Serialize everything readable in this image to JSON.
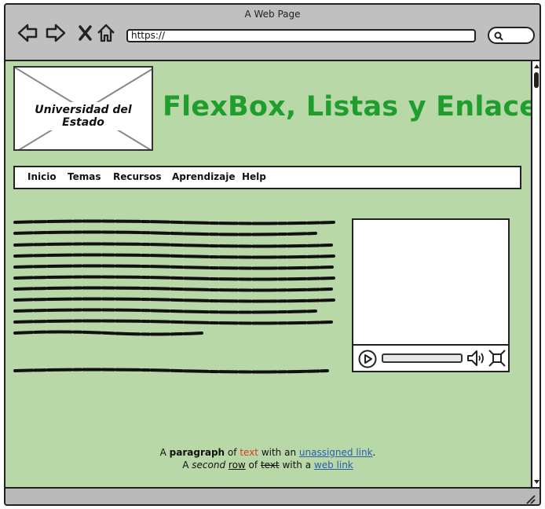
{
  "window": {
    "title": "A Web Page"
  },
  "address_bar": {
    "url": "https://"
  },
  "header": {
    "logo_label": "Universidad del Estado",
    "title": "FlexBox, Listas y Enlaces",
    "title_color": "#1f9e2e"
  },
  "menu": {
    "items": [
      {
        "label": "Inicio"
      },
      {
        "label": "Temas"
      },
      {
        "label": "Recursos"
      },
      {
        "label": "Aprendizaje"
      },
      {
        "label": "Help"
      }
    ]
  },
  "footer_text": {
    "line1": {
      "a": "A ",
      "bold": "paragraph",
      "of": " of ",
      "red": "text",
      "with": " with an ",
      "link": "unassigned link",
      "end": "."
    },
    "line2": {
      "a": "A ",
      "italic": "second",
      "sp": " ",
      "underlined": "row",
      "of": " of ",
      "strike": "text",
      "with": " with a ",
      "link": "web link"
    }
  },
  "colors": {
    "page_bg": "#b8d8a8",
    "link": "#2a5db0",
    "accent_red": "#d63a22"
  },
  "icons": [
    "back-arrow-icon",
    "forward-arrow-icon",
    "close-x-icon",
    "home-icon",
    "search-icon",
    "play-icon",
    "volume-icon",
    "fullscreen-icon",
    "scroll-up-icon",
    "scroll-down-icon",
    "resize-grip-icon"
  ]
}
